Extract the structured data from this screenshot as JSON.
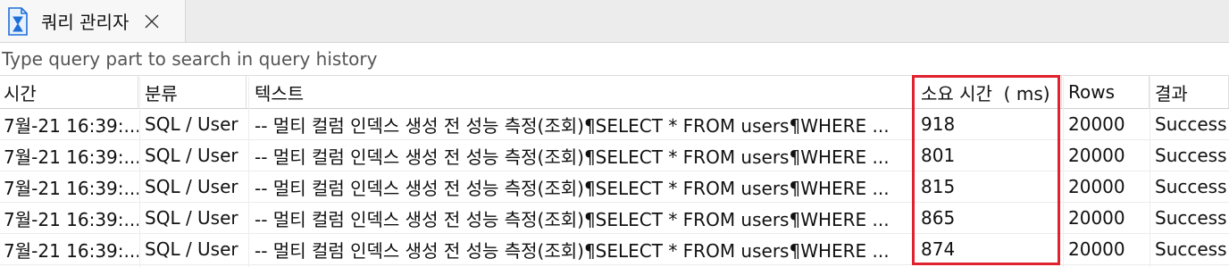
{
  "tab": {
    "title": "쿼리 관리자",
    "icon": "hourglass-file-icon",
    "close_icon": "close-icon"
  },
  "search": {
    "placeholder": "Type query part to search in query history",
    "value": ""
  },
  "table": {
    "headers": [
      "시간",
      "분류",
      "텍스트",
      "소요 시간  ( ms)",
      "Rows",
      "결과"
    ],
    "rows": [
      [
        "7월-21 16:39:...",
        "SQL / User",
        "-- 멀티 컬럼 인덱스 생성 전 성능 측정(조회)¶SELECT * FROM users¶WHERE ...",
        "918",
        "20000",
        "Success"
      ],
      [
        "7월-21 16:39:...",
        "SQL / User",
        "-- 멀티 컬럼 인덱스 생성 전 성능 측정(조회)¶SELECT * FROM users¶WHERE ...",
        "801",
        "20000",
        "Success"
      ],
      [
        "7월-21 16:39:...",
        "SQL / User",
        "-- 멀티 컬럼 인덱스 생성 전 성능 측정(조회)¶SELECT * FROM users¶WHERE ...",
        "815",
        "20000",
        "Success"
      ],
      [
        "7월-21 16:39:...",
        "SQL / User",
        "-- 멀티 컬럼 인덱스 생성 전 성능 측정(조회)¶SELECT * FROM users¶WHERE ...",
        "865",
        "20000",
        "Success"
      ],
      [
        "7월-21 16:39:...",
        "SQL / User",
        "-- 멀티 컬럼 인덱스 생성 전 성능 측정(조회)¶SELECT * FROM users¶WHERE ...",
        "874",
        "20000",
        "Success"
      ]
    ]
  },
  "colors": {
    "highlight": "#e0212e",
    "tab_bg": "#f7f7f7",
    "tabbar_bg": "#ececec",
    "icon_blue": "#1e6fd9"
  }
}
